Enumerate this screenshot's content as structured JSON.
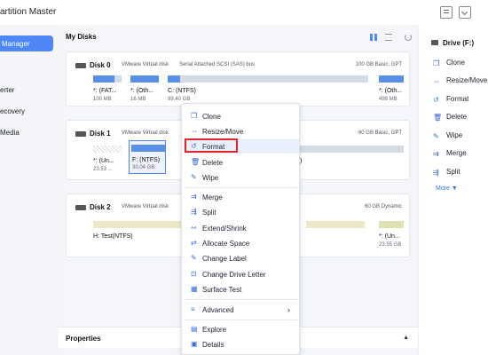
{
  "app": {
    "title": "artition Master"
  },
  "sidebar": {
    "items": [
      {
        "label": "Manager"
      },
      {
        "label": "erter"
      },
      {
        "label": "ecovery"
      },
      {
        "label": "Media"
      }
    ]
  },
  "main": {
    "title": "My Disks"
  },
  "disks": [
    {
      "name": "Disk 0",
      "type": "VMware Virtual disk",
      "bus": "Serial Attached SCSI (SAS) bus",
      "meta": "100 GB Basic, GPT",
      "partitions": [
        {
          "label": "*: (FAT...",
          "size": "100 MB"
        },
        {
          "label": "*: (Oth...",
          "size": "16 MB"
        },
        {
          "label": "C: (NTFS)",
          "size": "99.40 GB"
        },
        {
          "label": "*: (Oth...",
          "size": "499 MB"
        }
      ]
    },
    {
      "name": "Disk 1",
      "type": "VMware Virtual disk",
      "bus": "",
      "meta": "60 GB Basic, GPT",
      "partitions": [
        {
          "label": "*: (Un...",
          "size": "23.53 ..."
        },
        {
          "label": "F: (NTFS)",
          "size": "30.04 GB"
        },
        {
          "label": ")",
          "size": ""
        }
      ]
    },
    {
      "name": "Disk 2",
      "type": "VMware Virtual disk",
      "bus": "",
      "meta": "60 GB Dynamic",
      "partitions": [
        {
          "label": "H: Test(NTFS)",
          "size": ""
        },
        {
          "label": "*: (Un...",
          "size": "23.55 GB"
        }
      ]
    }
  ],
  "properties": {
    "title": "Properties"
  },
  "right_panel": {
    "title": "Drive (F:)",
    "items": [
      {
        "label": "Clone"
      },
      {
        "label": "Resize/Move"
      },
      {
        "label": "Format"
      },
      {
        "label": "Delete"
      },
      {
        "label": "Wipe"
      },
      {
        "label": "Merge"
      },
      {
        "label": "Split"
      }
    ],
    "more": "More ▼"
  },
  "context_menu": {
    "items": [
      {
        "label": "Clone"
      },
      {
        "label": "Resize/Move"
      },
      {
        "label": "Format"
      },
      {
        "label": "Delete"
      },
      {
        "label": "Wipe"
      },
      {
        "label": "Merge"
      },
      {
        "label": "Split"
      },
      {
        "label": "Extend/Shrink"
      },
      {
        "label": "Allocate Space"
      },
      {
        "label": "Change Label"
      },
      {
        "label": "Change Drive Letter"
      },
      {
        "label": "Surface Test"
      },
      {
        "label": "Advanced"
      },
      {
        "label": "Explore"
      },
      {
        "label": "Details"
      }
    ]
  },
  "colors": {
    "accent": "#4f87f6",
    "highlight": "#e0262b"
  }
}
